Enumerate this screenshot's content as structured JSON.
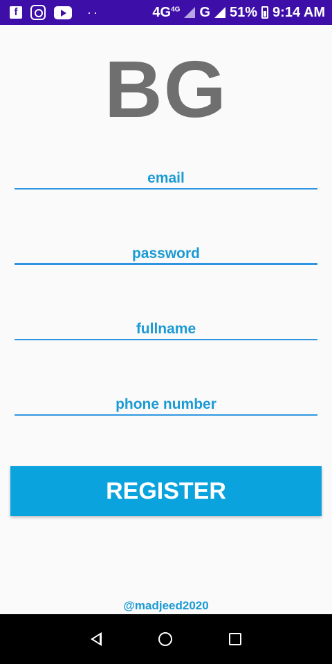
{
  "status_bar": {
    "network": "4G",
    "network_sup": "4G",
    "network2": "G",
    "battery": "51%",
    "time": "9:14 AM",
    "icons": [
      "facebook-icon",
      "instagram-icon",
      "youtube-icon",
      "more-dots-icon",
      "signal-icon",
      "battery-icon"
    ]
  },
  "logo": {
    "text": "BG"
  },
  "form": {
    "email_placeholder": "email",
    "password_placeholder": "password",
    "fullname_placeholder": "fullname",
    "phone_placeholder": "phone number",
    "register_label": "REGISTER"
  },
  "footer": {
    "credit": "@madjeed2020"
  },
  "colors": {
    "status_bar": "#3e0fa8",
    "accent": "#0aa3dd",
    "hint_text": "#1b9ad4",
    "logo": "#6f6f6f"
  },
  "nav_bar": {
    "icons": [
      "back-icon",
      "home-icon",
      "recent-apps-icon"
    ]
  }
}
